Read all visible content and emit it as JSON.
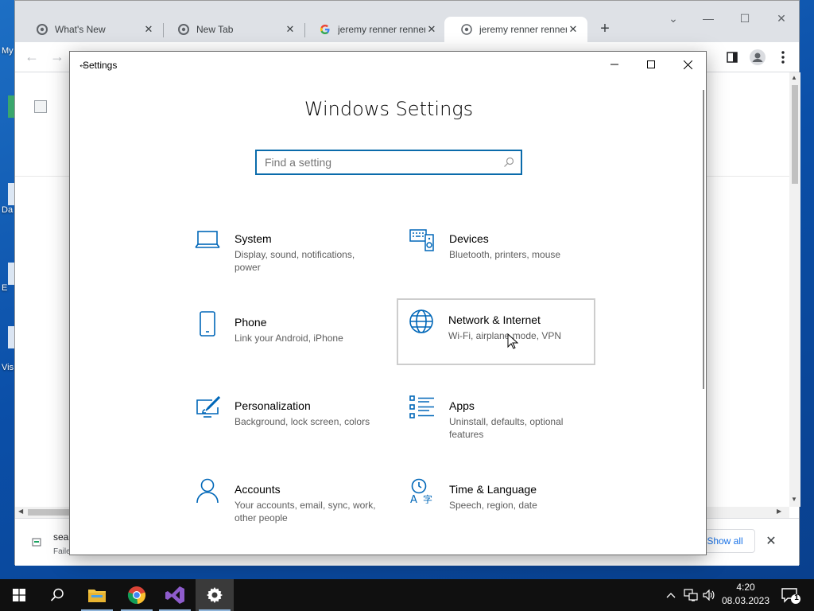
{
  "desktop": {
    "labels": [
      "My",
      "Da",
      "E",
      "Vis"
    ]
  },
  "browser": {
    "tabs": [
      {
        "title": "What's New",
        "favicon": "chrome-icon"
      },
      {
        "title": "New Tab",
        "favicon": "chrome-icon"
      },
      {
        "title": "jeremy renner renner",
        "favicon": "google-icon"
      },
      {
        "title": "jeremy renner renner",
        "favicon": "globe-icon"
      }
    ],
    "active_tab_index": 3,
    "new_tab_label": "+",
    "download": {
      "filename": "sea",
      "status": "Faile"
    },
    "show_all_label": "Show all"
  },
  "settings": {
    "window_title": "Settings",
    "heading": "Windows Settings",
    "search_placeholder": "Find a setting",
    "categories": [
      {
        "name": "System",
        "desc": "Display, sound, notifications, power",
        "icon": "laptop-icon"
      },
      {
        "name": "Devices",
        "desc": "Bluetooth, printers, mouse",
        "icon": "keyboard-speaker-icon"
      },
      {
        "name": "Phone",
        "desc": "Link your Android, iPhone",
        "icon": "phone-icon"
      },
      {
        "name": "Network & Internet",
        "desc": "Wi-Fi, airplane mode, VPN",
        "icon": "globe-icon"
      },
      {
        "name": "Personalization",
        "desc": "Background, lock screen, colors",
        "icon": "paint-monitor-icon"
      },
      {
        "name": "Apps",
        "desc": "Uninstall, defaults, optional features",
        "icon": "apps-list-icon"
      },
      {
        "name": "Accounts",
        "desc": "Your accounts, email, sync, work, other people",
        "icon": "person-icon"
      },
      {
        "name": "Time & Language",
        "desc": "Speech, region, date",
        "icon": "time-language-icon"
      }
    ],
    "hovered_category": "Network & Internet",
    "accent_color": "#0067b8"
  },
  "taskbar": {
    "apps": [
      "start-button",
      "search-button",
      "file-explorer",
      "chrome",
      "visual-studio",
      "settings"
    ],
    "time": "4:20",
    "date": "08.03.2023",
    "notification_count": "1"
  }
}
